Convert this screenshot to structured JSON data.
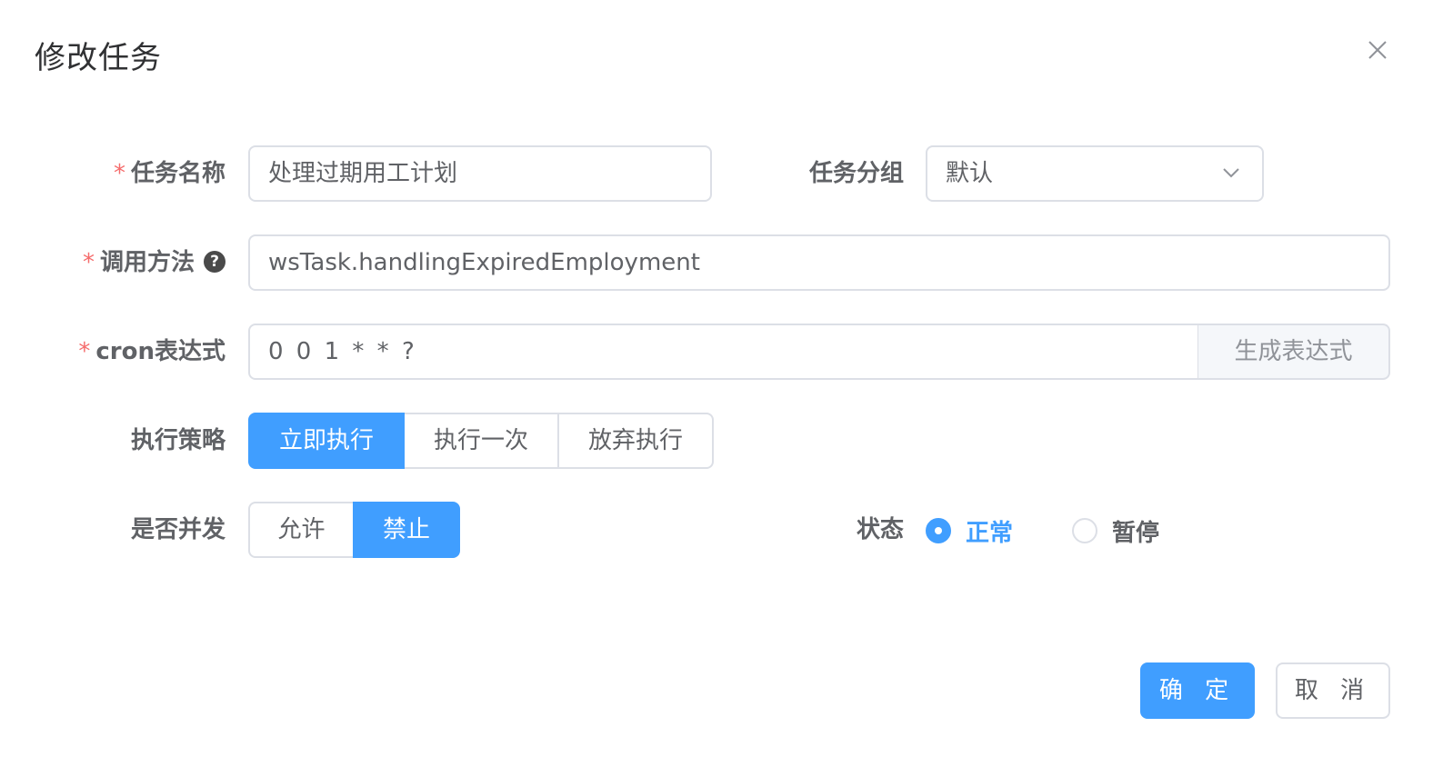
{
  "dialog": {
    "title": "修改任务",
    "close_icon": "close-icon"
  },
  "form": {
    "job_name": {
      "label": "任务名称",
      "required": "*",
      "value": "处理过期用工计划"
    },
    "job_group": {
      "label": "任务分组",
      "value": "默认",
      "caret_icon": "chevron-down-icon"
    },
    "invoke_target": {
      "label": "调用方法",
      "required": "*",
      "help_icon": "question-circle-icon",
      "help_glyph": "?",
      "value": "wsTask.handlingExpiredEmployment"
    },
    "cron": {
      "label": "cron表达式",
      "required": "*",
      "value": "0 0 1 * * ?",
      "append_button": "生成表达式"
    },
    "misfire_policy": {
      "label": "执行策略",
      "options": [
        "立即执行",
        "执行一次",
        "放弃执行"
      ],
      "selected_index": 0
    },
    "concurrent": {
      "label": "是否并发",
      "options": [
        "允许",
        "禁止"
      ],
      "selected_index": 1
    },
    "status": {
      "label": "状态",
      "options": [
        "正常",
        "暂停"
      ],
      "selected_index": 0
    }
  },
  "footer": {
    "confirm_label": "确 定",
    "cancel_label": "取 消"
  },
  "colors": {
    "primary": "#409eff",
    "required": "#f56c6c",
    "border": "#dcdfe6"
  }
}
